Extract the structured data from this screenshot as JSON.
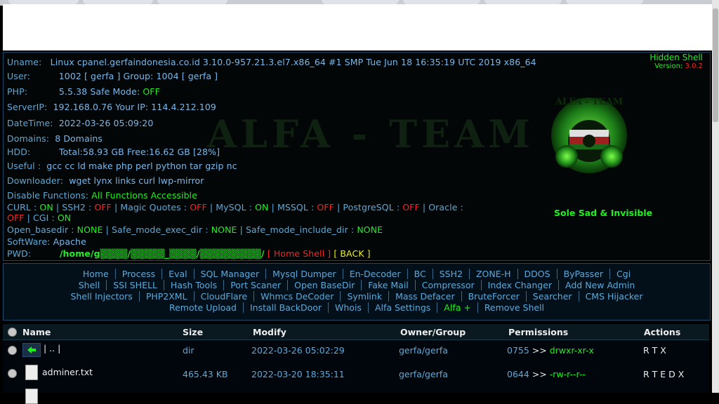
{
  "brand": {
    "title": "Hidden Shell",
    "version_label": "Version:",
    "version": "3.0.2"
  },
  "watermark": "ALFA - TEAM",
  "logo_text": "ALFA - TEAM",
  "tagline": "Sole Sad & Invisible",
  "info": {
    "uname_label": "Uname:",
    "uname": "Linux cpanel.gerfaindonesia.co.id 3.10.0-957.21.3.el7.x86_64 #1 SMP Tue Jun 18 16:35:19 UTC 2019 x86_64",
    "user_label": "User:",
    "user": "1002 [ gerfa ] Group: 1004 [ gerfa ]",
    "php_label": "PHP:",
    "php": "5.5.38 Safe Mode:",
    "safe_mode": "OFF",
    "server_ip_label": "ServerIP:",
    "server_ip": "192.168.0.76 Your IP: 114.4.212.109",
    "datetime_label": "DateTime:",
    "datetime": "2022-03-26 05:09:20",
    "domains_label": "Domains:",
    "domains": "8 Domains",
    "hdd_label": "HDD:",
    "hdd": "Total:58.93 GB Free:16.62 GB [28%]",
    "useful_label": "Useful :",
    "useful": "gcc cc ld make php perl python tar gzip nc",
    "downloader_label": "Downloader:",
    "downloader": "wget lynx links curl lwp-mirror",
    "disable_label": "Disable Functions:",
    "disable": "All Functions Accessible",
    "curl_label": "CURL :",
    "curl": "ON",
    "ssh2_label": "| SSH2 :",
    "ssh2": "OFF",
    "magic_label": "| Magic Quotes :",
    "magic": "OFF",
    "mysql_label": "| MySQL :",
    "mysql": "ON",
    "mssql_label": "| MSSQL :",
    "mssql": "OFF",
    "pgsql_label": "| PostgreSQL :",
    "pgsql": "OFF",
    "oracle_label": "| Oracle :",
    "oracle": "OFF",
    "cgi_label": "| CGI :",
    "cgi": "ON",
    "openbase_label": "Open_basedir :",
    "openbase": "NONE",
    "safeexec_label": "| Safe_mode_exec_dir :",
    "safeexec": "NONE",
    "safeinc_label": "| Safe_mode_include_dir :",
    "safeinc": "NONE",
    "software_label": "SoftWare:",
    "software": "Apache",
    "pwd_label": "PWD:",
    "pwd": "/home/g▒▒▒▒/▒▒▒▒▒_▒▒▒▒/▒▒▒▒▒▒▒▒▒/",
    "home_shell": "[ Home Shell ]",
    "back": "[ BACK ]"
  },
  "menu": {
    "line1": [
      "Home",
      "Process",
      "Eval",
      "SQL Manager",
      "Mysql Dumper",
      "En-Decoder",
      "BC",
      "SSH2",
      "ZONE-H",
      "DDOS",
      "ByPasser",
      "Cgi"
    ],
    "line2": [
      "Shell",
      "SSI SHELL",
      "Hash Tools",
      "Port Scaner",
      "Open BaseDir",
      "Fake Mail",
      "Compressor",
      "Index Changer",
      "Add New Admin"
    ],
    "line3": [
      "Shell Injectors",
      "PHP2XML",
      "CloudFlare",
      "Whmcs DeCoder",
      "Symlink",
      "Mass Defacer",
      "BruteForcer",
      "Searcher",
      "CMS Hijacker"
    ],
    "line4": [
      "Remote Upload",
      "Install BackDoor",
      "Whois",
      "Alfa Settings",
      "Alfa +",
      "Remove Shell"
    ]
  },
  "table": {
    "headers": {
      "name": "Name",
      "size": "Size",
      "modify": "Modify",
      "owner": "Owner/Group",
      "permissions": "Permissions",
      "actions": "Actions"
    },
    "rows": [
      {
        "name": "| .. |",
        "size": "dir",
        "modify": "2022-03-26 05:02:29",
        "owner": "gerfa/gerfa",
        "perm_num": "0755",
        "perm_sep": ">>",
        "perm_str": "drwxr-xr-x",
        "actions": "R T X"
      },
      {
        "name": "adminer.txt",
        "size": "465.43 KB",
        "modify": "2022-03-20 18:35:11",
        "owner": "gerfa/gerfa",
        "perm_num": "0644",
        "perm_sep": ">>",
        "perm_str": "-rw-r--r--",
        "actions": "R T E D X"
      }
    ]
  }
}
